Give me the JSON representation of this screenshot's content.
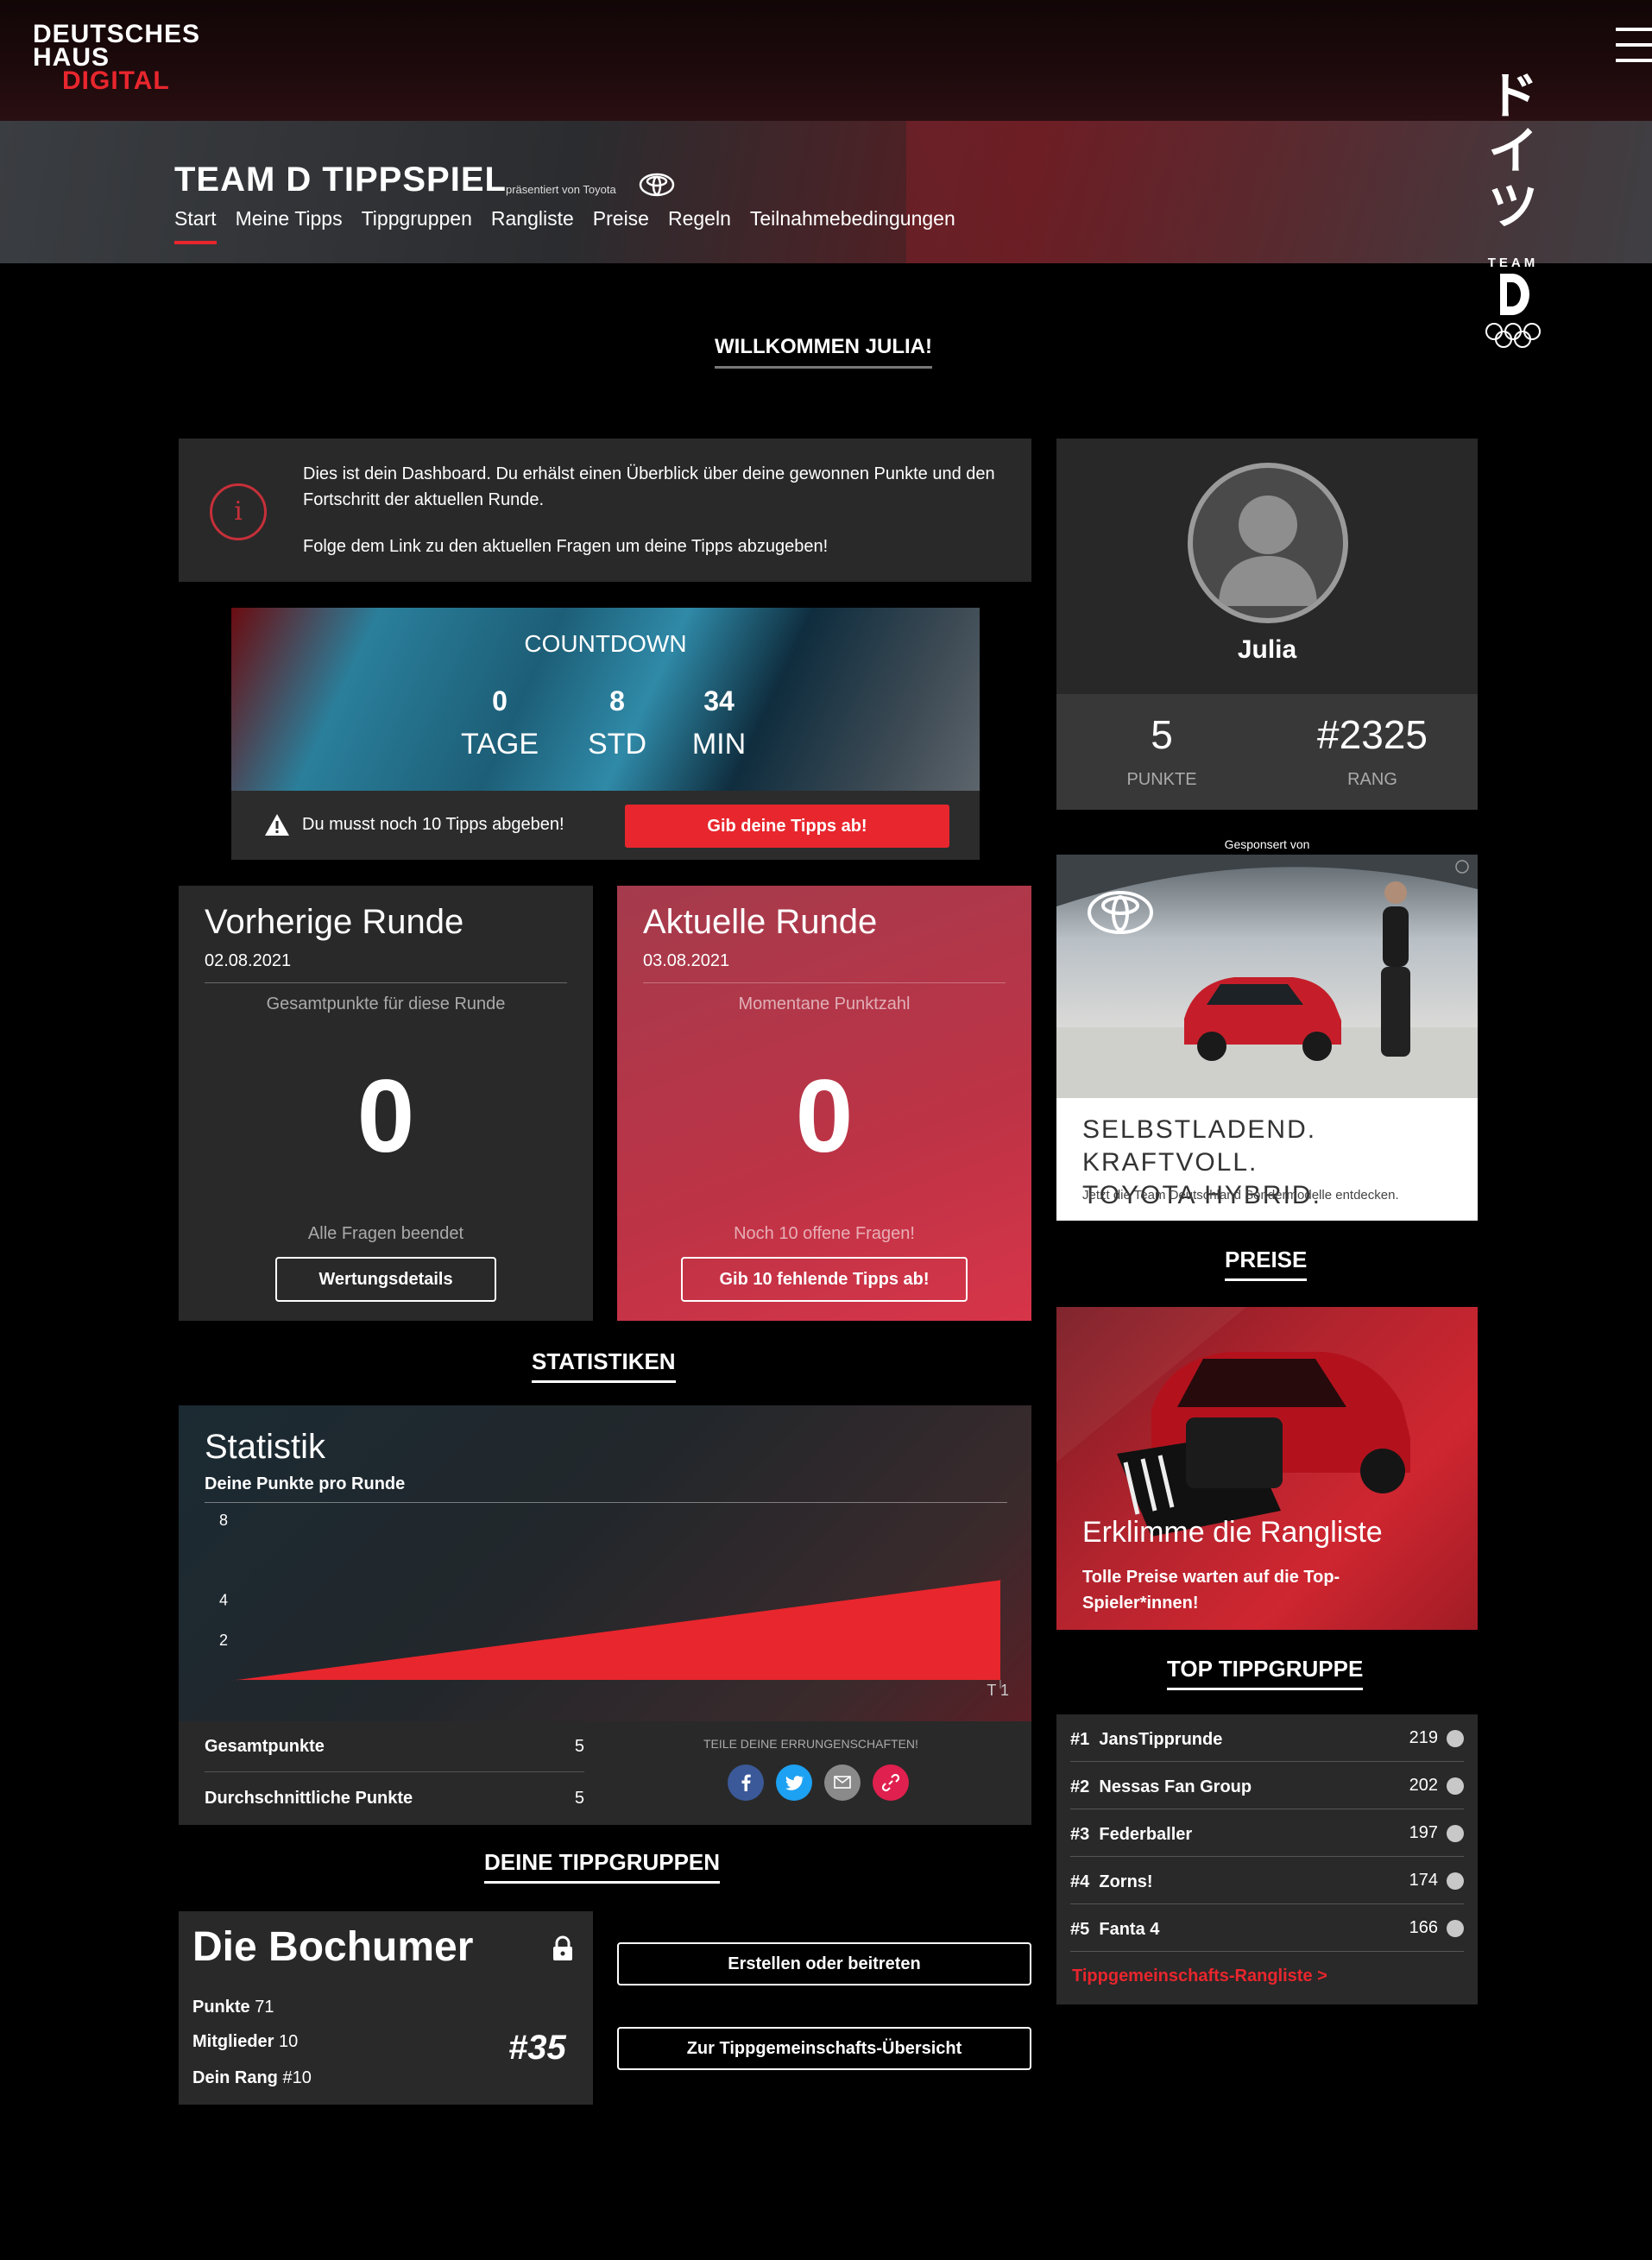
{
  "header": {
    "logo_line1": "DEUTSCHES",
    "logo_line2": "HAUS",
    "logo_line3": "DIGITAL",
    "title": "TEAM D TIPPSPIEL",
    "presented_by": "präsentiert von Toyota",
    "nav": [
      "Start",
      "Meine Tipps",
      "Tippgruppen",
      "Rangliste",
      "Preise",
      "Regeln",
      "Teilnahmebedingungen"
    ],
    "active_nav": "Start",
    "side_kana": [
      "ド",
      "イ",
      "ツ"
    ],
    "side_team": "TEAM"
  },
  "welcome": "WILLKOMMEN JULIA!",
  "info": {
    "line1": "Dies ist dein Dashboard. Du erhälst einen Überblick über deine gewonnen Punkte und den Fortschritt der aktuellen Runde.",
    "line2": "Folge dem Link zu den aktuellen Fragen um deine Tipps abzugeben!"
  },
  "countdown": {
    "title": "COUNTDOWN",
    "days": "0",
    "days_label": "TAGE",
    "hours": "8",
    "hours_label": "STD",
    "minutes": "34",
    "minutes_label": "MIN",
    "warning": "Du musst noch 10 Tipps abgeben!",
    "button": "Gib deine Tipps ab!"
  },
  "previous_round": {
    "title": "Vorherige Runde",
    "date": "02.08.2021",
    "caption": "Gesamtpunkte für diese Runde",
    "points": "0",
    "note": "Alle Fragen beendet",
    "button": "Wertungsdetails"
  },
  "current_round": {
    "title": "Aktuelle Runde",
    "date": "03.08.2021",
    "caption": "Momentane Punktzahl",
    "points": "0",
    "note": "Noch 10 offene Fragen!",
    "button": "Gib 10 fehlende Tipps ab!"
  },
  "statistics": {
    "section_title": "STATISTIKEN",
    "title": "Statistik",
    "subtitle": "Deine Punkte pro Runde",
    "total_label": "Gesamtpunkte",
    "total_value": "5",
    "avg_label": "Durchschnittliche Punkte",
    "avg_value": "5",
    "share_label": "TEILE DEINE ERRUNGENSCHAFTEN!"
  },
  "chart_data": {
    "type": "area",
    "title": "",
    "x": [
      "",
      "T 1"
    ],
    "values": [
      0,
      5
    ],
    "y_ticks": [
      2,
      4,
      8
    ],
    "ylim": [
      0,
      9
    ],
    "color": "#e8262d"
  },
  "groups": {
    "section_title": "DEINE TIPPGRUPPEN",
    "name": "Die Bochumer",
    "points_label": "Punkte",
    "points": "71",
    "members_label": "Mitglieder",
    "members": "10",
    "rank_label": "Dein Rang",
    "rank": "#10",
    "group_rank": "#35",
    "button_create": "Erstellen oder beitreten",
    "button_overview": "Zur Tippgemeinschafts-Übersicht"
  },
  "profile": {
    "name": "Julia",
    "points": "5",
    "points_label": "PUNKTE",
    "rank": "#2325",
    "rank_label": "RANG"
  },
  "ad": {
    "sponsor_label": "Gesponsert von",
    "headline1": "SELBSTLADEND. KRAFTVOLL.",
    "headline2": "TOYOTA HYBRID.",
    "small": "Jetzt die Team Deutschland Sondermodelle entdecken."
  },
  "prizes": {
    "section_title": "PREISE",
    "headline": "Erklimme die Rangliste",
    "text": "Tolle Preise warten auf die Top-Spieler*innen!"
  },
  "top_groups": {
    "section_title": "TOP TIPPGRUPPE",
    "rows": [
      {
        "rank": "#1",
        "name": "JansTipprunde",
        "score": "219"
      },
      {
        "rank": "#2",
        "name": "Nessas Fan Group",
        "score": "202"
      },
      {
        "rank": "#3",
        "name": "Federballer",
        "score": "197"
      },
      {
        "rank": "#4",
        "name": "Zorns!",
        "score": "174"
      },
      {
        "rank": "#5",
        "name": "Fanta 4",
        "score": "166"
      }
    ],
    "link": "Tippgemeinschafts-Rangliste >"
  },
  "colors": {
    "accent": "#e8262d",
    "panel": "#292929",
    "current_round": "#c0374a"
  }
}
